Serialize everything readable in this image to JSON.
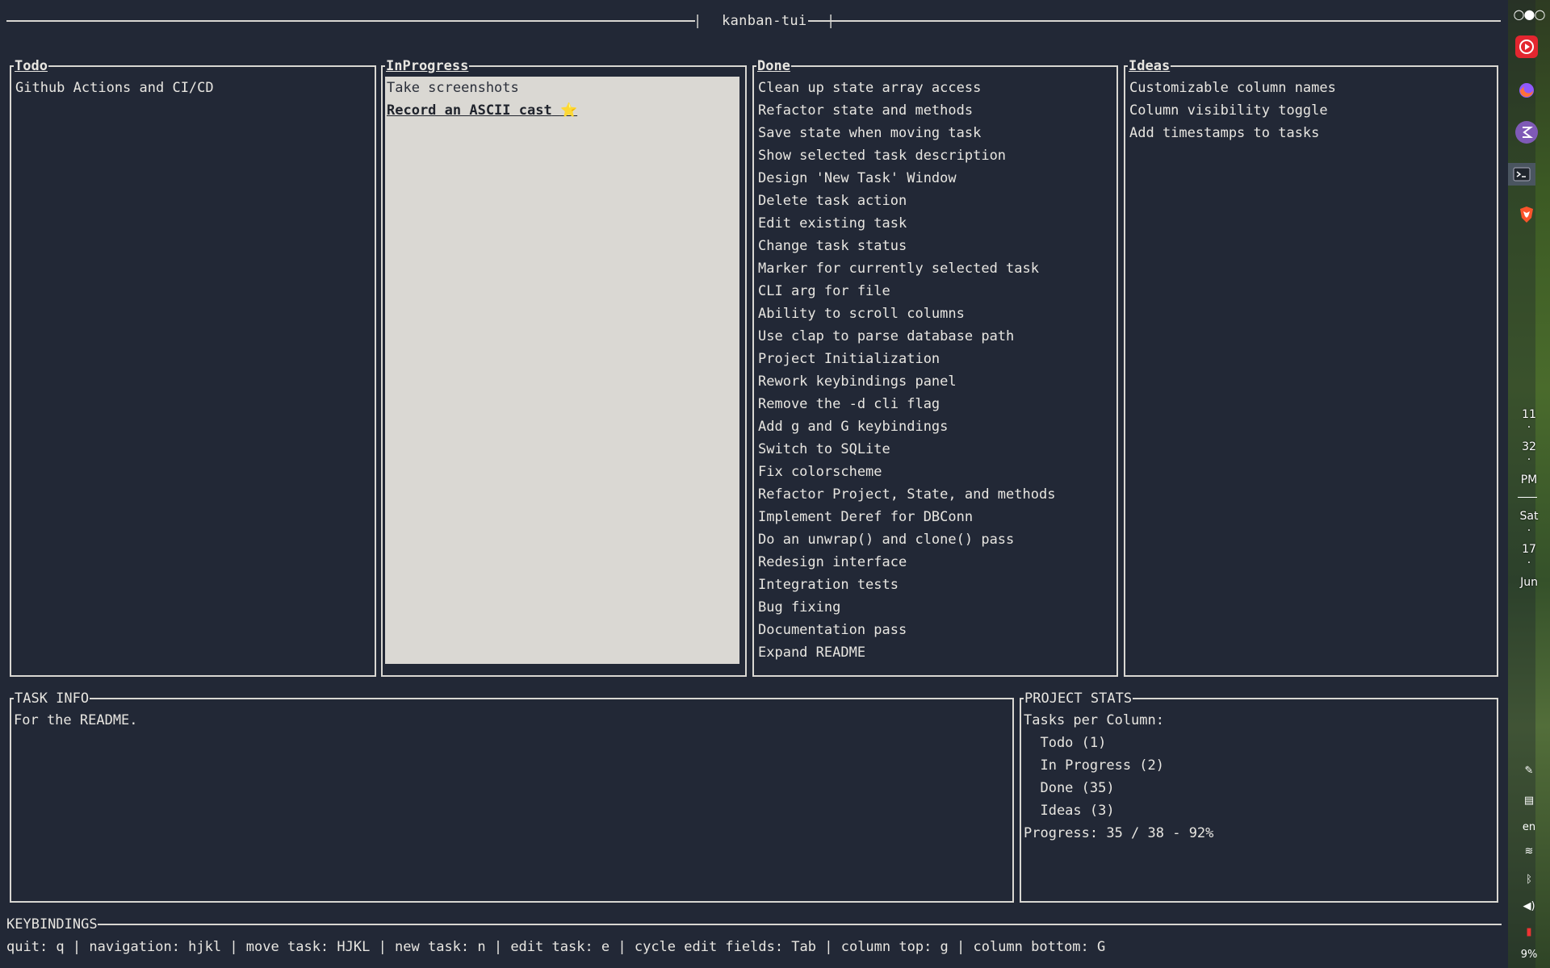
{
  "app": {
    "title": "kanban-tui",
    "title_bar_left": "|",
    "title_bar_right": "|"
  },
  "columns": [
    {
      "title": "Todo",
      "tasks": [
        "Github Actions and CI/CD"
      ]
    },
    {
      "title": "InProgress",
      "tasks": [
        "Take screenshots",
        "Record an ASCII cast"
      ],
      "selected_index": 1,
      "selected_suffix": "⭐"
    },
    {
      "title": "Done",
      "tasks": [
        "Clean up state array access",
        "Refactor state and methods",
        "Save state when moving task",
        "Show selected task description",
        "Design 'New Task' Window",
        "Delete task action",
        "Edit existing task",
        "Change task status",
        "Marker for currently selected task",
        "CLI arg for file",
        "Ability to scroll columns",
        "Use clap to parse database path",
        "Project Initialization",
        "Rework keybindings panel",
        "Remove the -d cli flag",
        "Add g and G keybindings",
        "Switch to SQLite",
        "Fix colorscheme",
        "Refactor Project, State, and methods",
        "Implement Deref for DBConn",
        "Do an unwrap() and clone() pass",
        "Redesign interface",
        "Integration tests",
        "Bug fixing",
        "Documentation pass",
        "Expand README"
      ]
    },
    {
      "title": "Ideas",
      "tasks": [
        "Customizable column names",
        "Column visibility toggle",
        "Add timestamps to tasks"
      ]
    }
  ],
  "task_info": {
    "title": "TASK INFO",
    "description": "For the README."
  },
  "project_stats": {
    "title": "PROJECT STATS",
    "heading": "Tasks per Column:",
    "rows": [
      "  Todo (1)",
      "  In Progress (2)",
      "  Done (35)",
      "  Ideas (3)"
    ],
    "progress": "Progress: 35 / 38 - 92%",
    "progress_fraction": 0.92
  },
  "keybindings": {
    "title": "KEYBINDINGS",
    "text": "quit: q | navigation: hjkl | move task: HJKL | new task: n | edit task: e | cycle edit fields: Tab | column top: g | column bottom: G"
  },
  "dock": {
    "icons": [
      "dots-icon",
      "youtube-music-icon",
      "firefox-icon",
      "emacs-icon",
      "terminal-icon",
      "brave-icon"
    ],
    "clock": {
      "hour": "11",
      "minute": "32",
      "ampm": "PM"
    },
    "date": {
      "weekday": "Sat",
      "day": "17",
      "month": "Jun"
    },
    "lang": "en",
    "battery": "9%",
    "colors": {
      "youtube": "#e3262f",
      "firefox": "#ff7139",
      "emacs": "#7f5ab6",
      "brave": "#fb542b"
    }
  }
}
